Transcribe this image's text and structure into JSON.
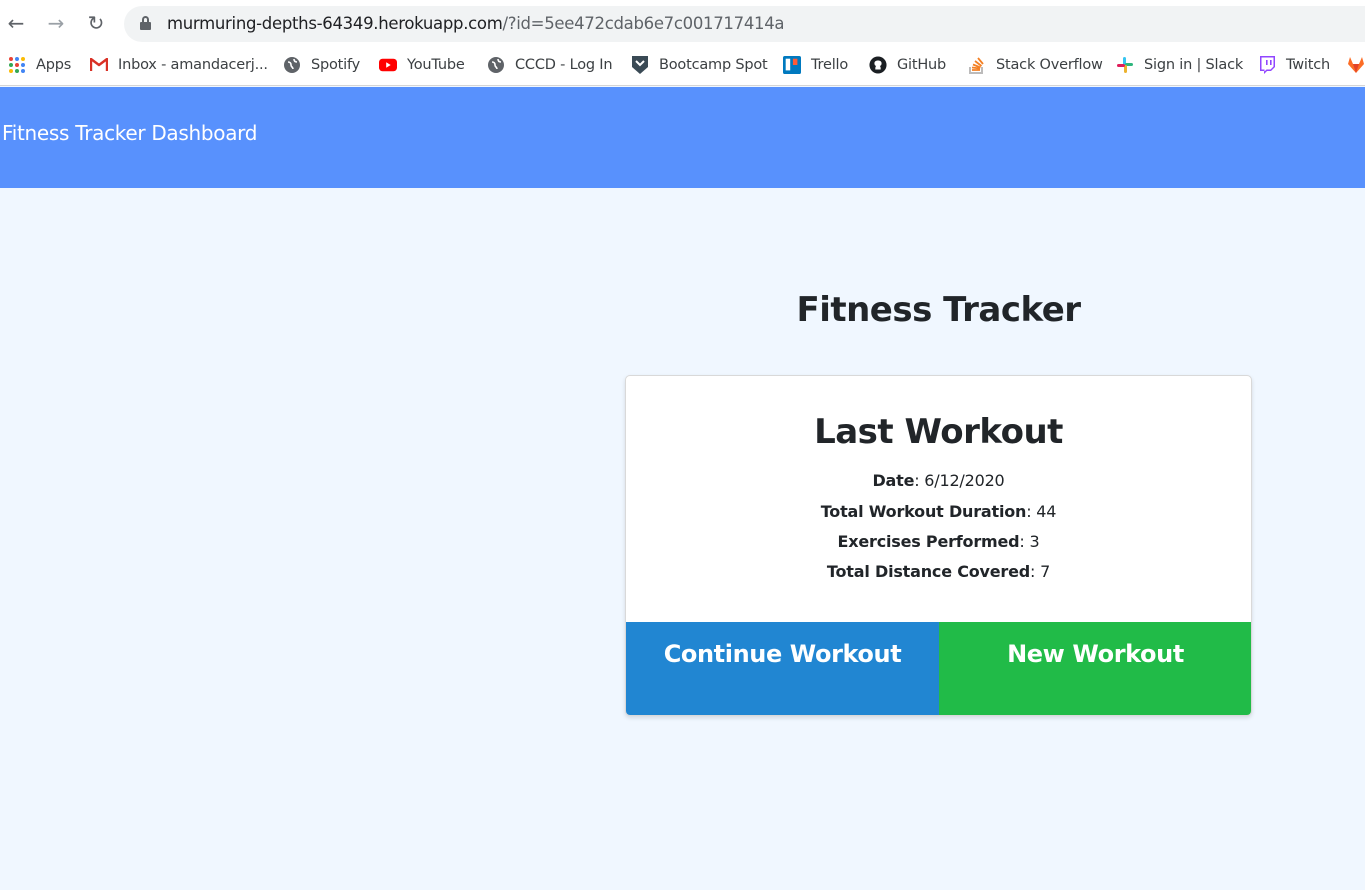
{
  "browser": {
    "url_host": "murmuring-depths-64349.herokuapp.com",
    "url_path": "/?id=5ee472cdab6e7c001717414a",
    "bookmarks": [
      {
        "label": "Apps",
        "icon": "apps-grid-icon"
      },
      {
        "label": "Inbox - amandacerj...",
        "icon": "gmail-icon"
      },
      {
        "label": "Spotify",
        "icon": "globe-icon"
      },
      {
        "label": "YouTube",
        "icon": "youtube-icon"
      },
      {
        "label": "CCCD - Log In",
        "icon": "globe-icon"
      },
      {
        "label": "Bootcamp Spot",
        "icon": "bootcamp-icon"
      },
      {
        "label": "Trello",
        "icon": "trello-icon"
      },
      {
        "label": "GitHub",
        "icon": "github-icon"
      },
      {
        "label": "Stack Overflow",
        "icon": "stackoverflow-icon"
      },
      {
        "label": "Sign in | Slack",
        "icon": "slack-icon"
      },
      {
        "label": "Twitch",
        "icon": "twitch-icon"
      }
    ]
  },
  "navbar": {
    "brand": "Fitness Tracker Dashboard"
  },
  "main": {
    "title": "Fitness Tracker",
    "card": {
      "title": "Last Workout",
      "stats": [
        {
          "label": "Date",
          "value": ": 6/12/2020"
        },
        {
          "label": "Total Workout Duration",
          "value": ": 44"
        },
        {
          "label": "Exercises Performed",
          "value": ": 3"
        },
        {
          "label": "Total Distance Covered",
          "value": ": 7"
        }
      ],
      "continue_label": "Continue Workout",
      "new_label": "New Workout"
    }
  },
  "colors": {
    "navbar": "#5891fd",
    "background": "#f0f7ff",
    "continue_button": "#2186d2",
    "new_button": "#21bb48"
  }
}
